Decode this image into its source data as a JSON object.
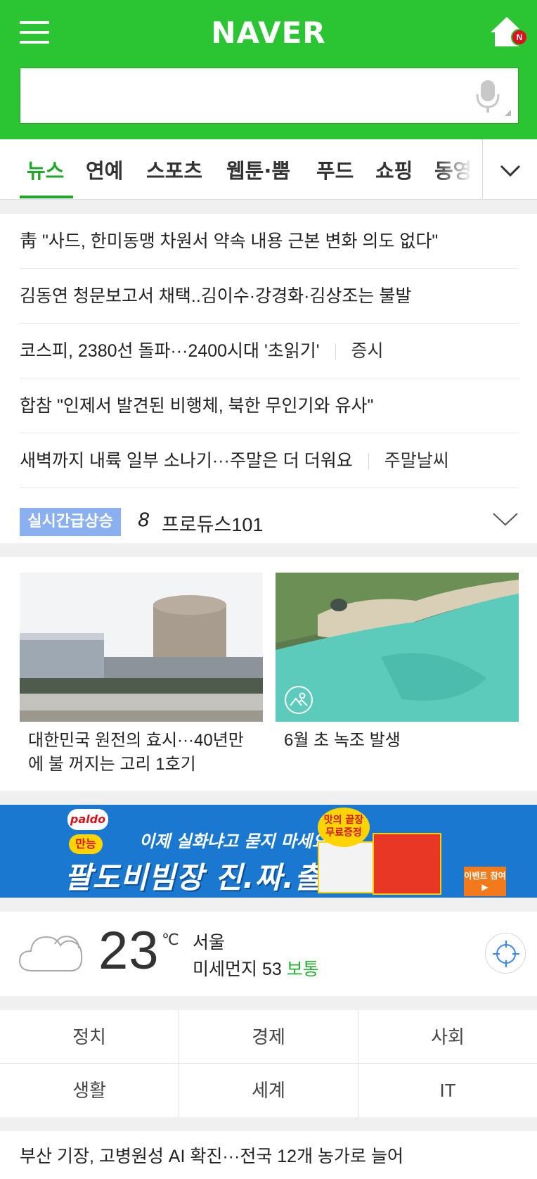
{
  "header": {
    "logo": "NAVER",
    "home_badge": "N",
    "search_placeholder": "",
    "brand_color": "#2bc534"
  },
  "tabs": [
    "뉴스",
    "연예",
    "스포츠",
    "웹툰·뿜",
    "푸드",
    "쇼핑",
    "동영"
  ],
  "active_tab": "뉴스",
  "headlines": [
    {
      "title": "靑 \"사드, 한미동맹 차원서 약속 내용 근본 변화 의도 없다\"",
      "tag": ""
    },
    {
      "title": "김동연 청문보고서 채택..김이수·강경화·김상조는 불발",
      "tag": ""
    },
    {
      "title": "코스피, 2380선 돌파···2400시대 '초읽기'",
      "tag": "증시"
    },
    {
      "title": "합참 \"인제서 발견된 비행체, 북한 무인기와 유사\"",
      "tag": ""
    },
    {
      "title": "새벽까지 내륙 일부 소나기···주말은 더 더워요",
      "tag": "주말날씨"
    }
  ],
  "realtime": {
    "badge": "실시간급상승",
    "rank": "8",
    "term": "프로듀스101"
  },
  "photo_cards": [
    {
      "caption": "대한민국 원전의 효시···40년만에 불 꺼지는 고리 1호기",
      "line1": "대한민국 원전의 효시···40년만",
      "line2": "에 불 꺼지는 고리 1호기",
      "icon": "none"
    },
    {
      "caption": "6월 초 녹조 발생",
      "line1": "6월 초 녹조 발생",
      "line2": "",
      "icon": "gallery-icon"
    }
  ],
  "ad": {
    "brand": "paldo",
    "tag": "만능",
    "copy": "이제 실화냐고 묻지 마세요",
    "main": "팔도비빔장 진.짜.출.시!!",
    "free": "맛의 끝장 무료증정",
    "event": "이벤트 참여 ▶",
    "background": "#1a78d0"
  },
  "weather": {
    "temp": "23",
    "unit": "℃",
    "city": "서울",
    "dust_label": "미세먼지 53",
    "dust_status": "보통",
    "icon": "cloud-icon"
  },
  "categories": [
    "정치",
    "경제",
    "사회",
    "생활",
    "세계",
    "IT"
  ],
  "bottom_news": "부산 기장, 고병원성 AI 확진···전국 12개 농가로 늘어"
}
